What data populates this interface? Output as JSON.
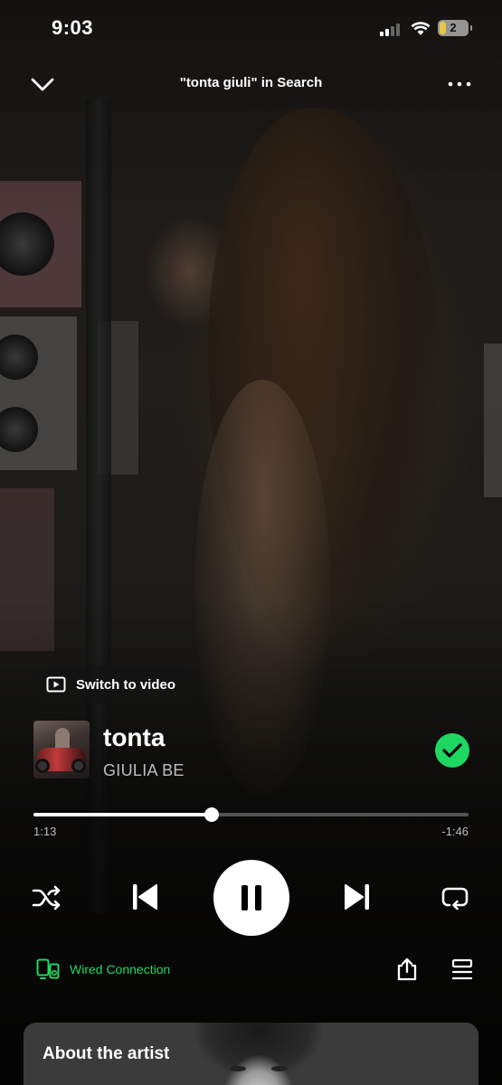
{
  "status_bar": {
    "time": "9:03",
    "battery": "2"
  },
  "header": {
    "context_title": "\"tonta giuli\" in Search"
  },
  "video": {
    "switch_label": "Switch to video"
  },
  "track": {
    "title": "tonta",
    "artist": "GIULIA BE",
    "liked": true
  },
  "playback": {
    "elapsed": "1:13",
    "remaining": "-1:46",
    "progress_fraction": 0.41,
    "state": "playing"
  },
  "device": {
    "label": "Wired Connection"
  },
  "artist_card": {
    "label": "About the artist"
  },
  "colors": {
    "accent": "#1ed760"
  },
  "icons": {
    "collapse": "chevron-down-icon",
    "more": "more-dots-icon",
    "video": "video-icon",
    "liked": "check-circle-icon",
    "shuffle": "shuffle-icon",
    "previous": "skip-previous-icon",
    "pause": "pause-icon",
    "next": "skip-next-icon",
    "repeat": "repeat-icon",
    "device": "connect-device-icon",
    "share": "share-icon",
    "queue": "queue-icon"
  }
}
